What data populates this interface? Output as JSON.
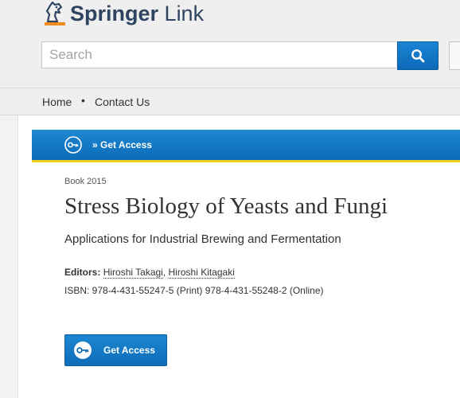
{
  "header": {
    "logo_word_1": "Springer",
    "logo_word_2": "Link",
    "search": {
      "placeholder": "Search"
    }
  },
  "breadcrumb": {
    "items": [
      "Home",
      "Contact Us"
    ],
    "separator": "•"
  },
  "access_bar": {
    "label": "» Get Access"
  },
  "book": {
    "type_year": "Book 2015",
    "title": "Stress Biology of Yeasts and Fungi",
    "subtitle": "Applications for Industrial Brewing and Fermentation",
    "editors_label": "Editors:",
    "editor_1": "Hiroshi Takagi",
    "editor_sep": ", ",
    "editor_2": "Hiroshi Kitagaki",
    "isbn": "ISBN: 978-4-431-55247-5 (Print) 978-4-431-55248-2 (Online)"
  },
  "access_button": {
    "label": "Get Access"
  },
  "colors": {
    "brand_blue": "#0d6db9",
    "accent_orange": "#f08b1d",
    "accent_yellow": "#f5d21f",
    "logo_navy": "#2f4461"
  },
  "icons": [
    "springer-horse-logo-icon",
    "magnifier-search-icon",
    "key-icon"
  ]
}
